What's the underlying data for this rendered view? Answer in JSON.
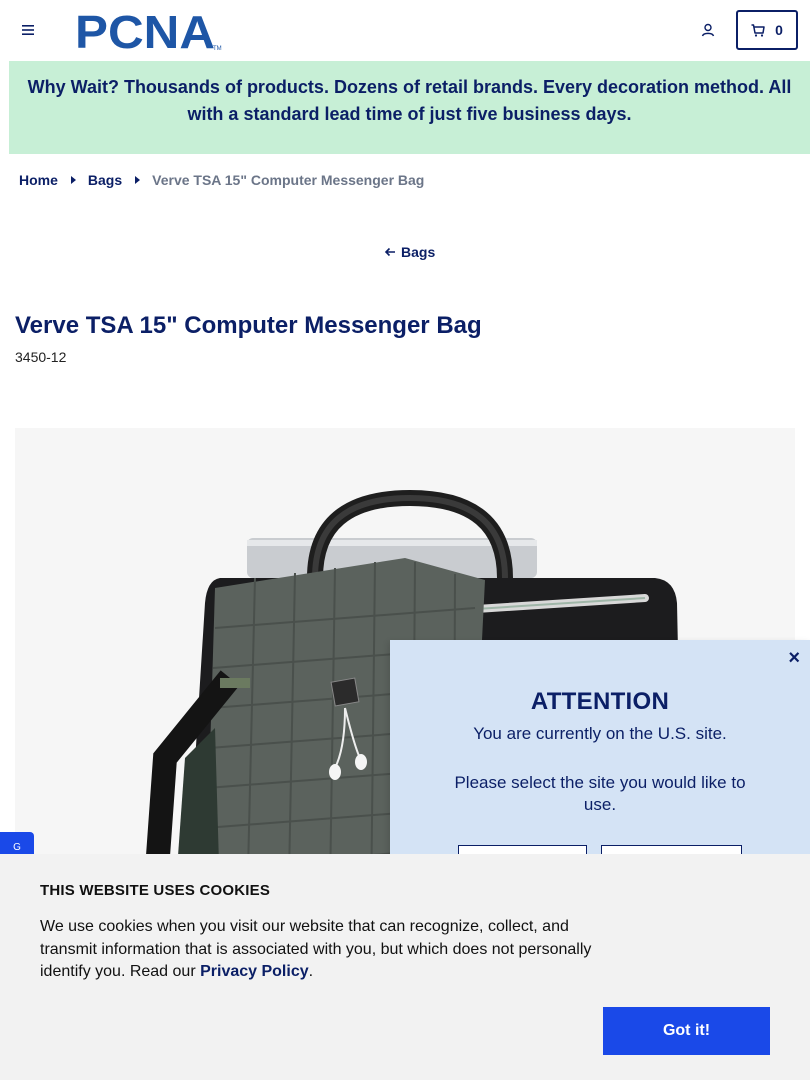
{
  "header": {
    "logo_text": "PCNA",
    "logo_tm": "TM",
    "cart_count": "0",
    "brand_color": "#0b1f66"
  },
  "banner": {
    "text": "Why Wait? Thousands of products. Dozens of retail brands. Every decoration method. All with a standard lead time of just five business days.",
    "bg_color": "#c7efd6"
  },
  "breadcrumb": {
    "items": [
      {
        "label": "Home"
      },
      {
        "label": "Bags"
      },
      {
        "label": "Verve TSA 15\" Computer Messenger Bag"
      }
    ]
  },
  "back_link": {
    "label": "Bags"
  },
  "product": {
    "title": "Verve TSA 15\" Computer Messenger Bag",
    "sku": "3450-12"
  },
  "side_tab": {
    "label": "G"
  },
  "modal": {
    "title": "ATTENTION",
    "text1": "You are currently on the U.S. site.",
    "text2": "Please select the site you would like to use.",
    "close_label": "×"
  },
  "cookie": {
    "title": "THIS WEBSITE USES COOKIES",
    "text_before_link": "We use cookies when you visit our website that can recognize, collect, and transmit information that is associated with you, but which does not personally identify you. Read our ",
    "link_label": "Privacy Policy",
    "text_after_link": ".",
    "button_label": "Got it!",
    "button_color": "#1a49e8"
  }
}
